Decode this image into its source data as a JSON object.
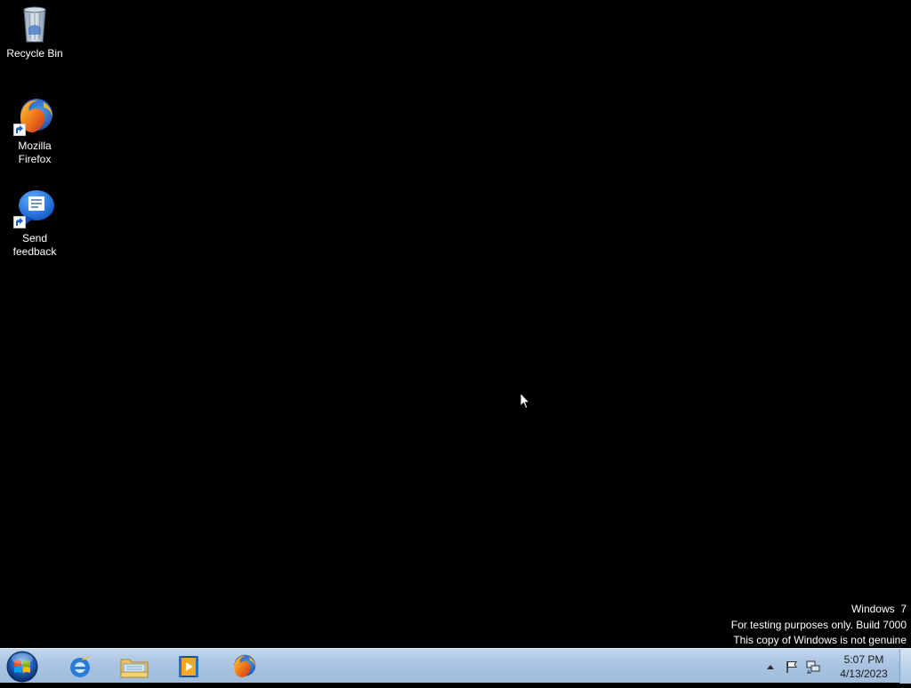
{
  "desktop": {
    "icons": [
      {
        "label": "Recycle Bin",
        "icon": "recycle-bin-icon"
      },
      {
        "label": "Mozilla Firefox",
        "label_line1": "Mozilla",
        "label_line2": "Firefox",
        "icon": "firefox-icon"
      },
      {
        "label": "Send feedback",
        "label_line1": "Send",
        "label_line2": "feedback",
        "icon": "feedback-icon"
      }
    ],
    "background_color": "#000000"
  },
  "watermark": {
    "line1": "Windows  7",
    "line2": "For testing purposes only. Build 7000",
    "line3": "This copy of Windows is not genuine"
  },
  "taskbar": {
    "pinned": [
      {
        "icon": "start-orb-icon"
      },
      {
        "icon": "internet-explorer-icon"
      },
      {
        "icon": "windows-explorer-icon"
      },
      {
        "icon": "media-player-icon"
      },
      {
        "icon": "firefox-icon"
      }
    ],
    "tray": {
      "icons": [
        "show-hidden-icons-arrow",
        "action-center-flag-icon",
        "network-icon"
      ],
      "time": "5:07 PM",
      "date": "4/13/2023"
    }
  },
  "colors": {
    "taskbar": "#a9c4e2",
    "text": "#ffffff"
  }
}
